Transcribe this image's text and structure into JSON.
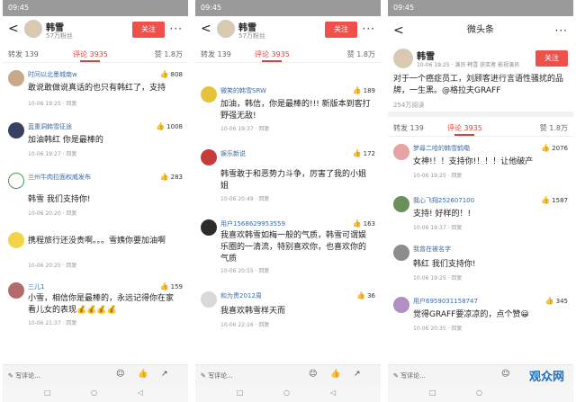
{
  "phone1": {
    "status_time": "09:45",
    "author": "韩雪",
    "fans": "57万粉丝",
    "follow": "关注",
    "tabs": [
      "转发 139",
      "评论 3935",
      "赞 1.8万"
    ],
    "comments": [
      {
        "name": "时间以北墨城南w",
        "likes": "808",
        "text": "敢说敢做说真话的也只有韩红了，支持",
        "time": "10-06 19:25 · 回复"
      },
      {
        "name": "蓝重洞韩雪征途",
        "likes": "1008",
        "text": "加油韩红 你是最棒的",
        "time": "10-06 19:27 · 回复"
      },
      {
        "name": "兰州牛肉拉面权威发布",
        "likes": "283",
        "text": "韩雪 我们支持你!",
        "time": "10-06 20:20 · 回复"
      },
      {
        "name": "",
        "likes": "",
        "text": "携程旅行还没贵啊。。。雪姨你要加油啊",
        "time": "10-06 20:25 · 回复"
      },
      {
        "name": "三儿1",
        "likes": "159",
        "text": "小雪，相信你是最棒的，永远记得你在家看儿女的表现💰💰💰💰",
        "time": "10-06 21:37 · 回复"
      }
    ],
    "write": "写评论..."
  },
  "phone2": {
    "status_time": "09:45",
    "author": "韩雪",
    "fans": "57万粉丝",
    "follow": "关注",
    "tabs": [
      "转发 139",
      "评论 3935",
      "赞 1.8万"
    ],
    "comments": [
      {
        "name": "微笑的韩雪SRW",
        "likes": "189",
        "text": "加油，韩信，你是最棒的!!! 新版本到客打野强无敌!",
        "time": "10-06 19:37 · 回复"
      },
      {
        "name": "娱乐新说",
        "likes": "172",
        "text": "韩雪敢于和恶势力斗争，厉害了我的小姐姐",
        "time": "10-06 20:49 · 回复"
      },
      {
        "name": "用户1568629953559",
        "likes": "163",
        "text": "我喜欢韩雪如梅一般的气质，韩雪可谓娱乐圈的一清流，特别喜欢你，也喜欢你的气质",
        "time": "10-06 20:55 · 回复"
      },
      {
        "name": "和为贵2012周",
        "likes": "36",
        "text": "我喜欢韩雪样天而",
        "time": "10-06 22:16 · 回复"
      }
    ],
    "write": "写评论..."
  },
  "phone3": {
    "status_time": "09:45",
    "title": "微头条",
    "author": "韩雪",
    "meta": "10-06 19:25 · 演员 韩雪 获奖者 影视演员",
    "follow": "关注",
    "body": "对于一个癌症员工，刘顾客进行言语性骚扰的品牌，一生黑。@格拉夫GRAFF",
    "reads": "254万阅读",
    "tabs": [
      "转发 139",
      "评论 3935",
      "赞 1.8万"
    ],
    "comments": [
      {
        "name": "梦尋二哈的韩雪鹤嘞",
        "likes": "2076",
        "text": "女神!！！支持你!！！！让他破产",
        "time": "10-06 19:25 · 回复"
      },
      {
        "name": "我心飞翔252607100",
        "likes": "1587",
        "text": "支持! 好样的！!",
        "time": "10-06 19:37 · 回复"
      },
      {
        "name": "我曾在被名字",
        "likes": "",
        "text": "韩红 我们支持你!",
        "time": "10-06 19:25 · 回复"
      },
      {
        "name": "用户6959031158747",
        "likes": "345",
        "text": "觉得GRAFF要凉凉的，点个赞😀",
        "time": "10-06 20:35 · 回复"
      }
    ],
    "write": "写评论..."
  },
  "watermark": "观众网"
}
